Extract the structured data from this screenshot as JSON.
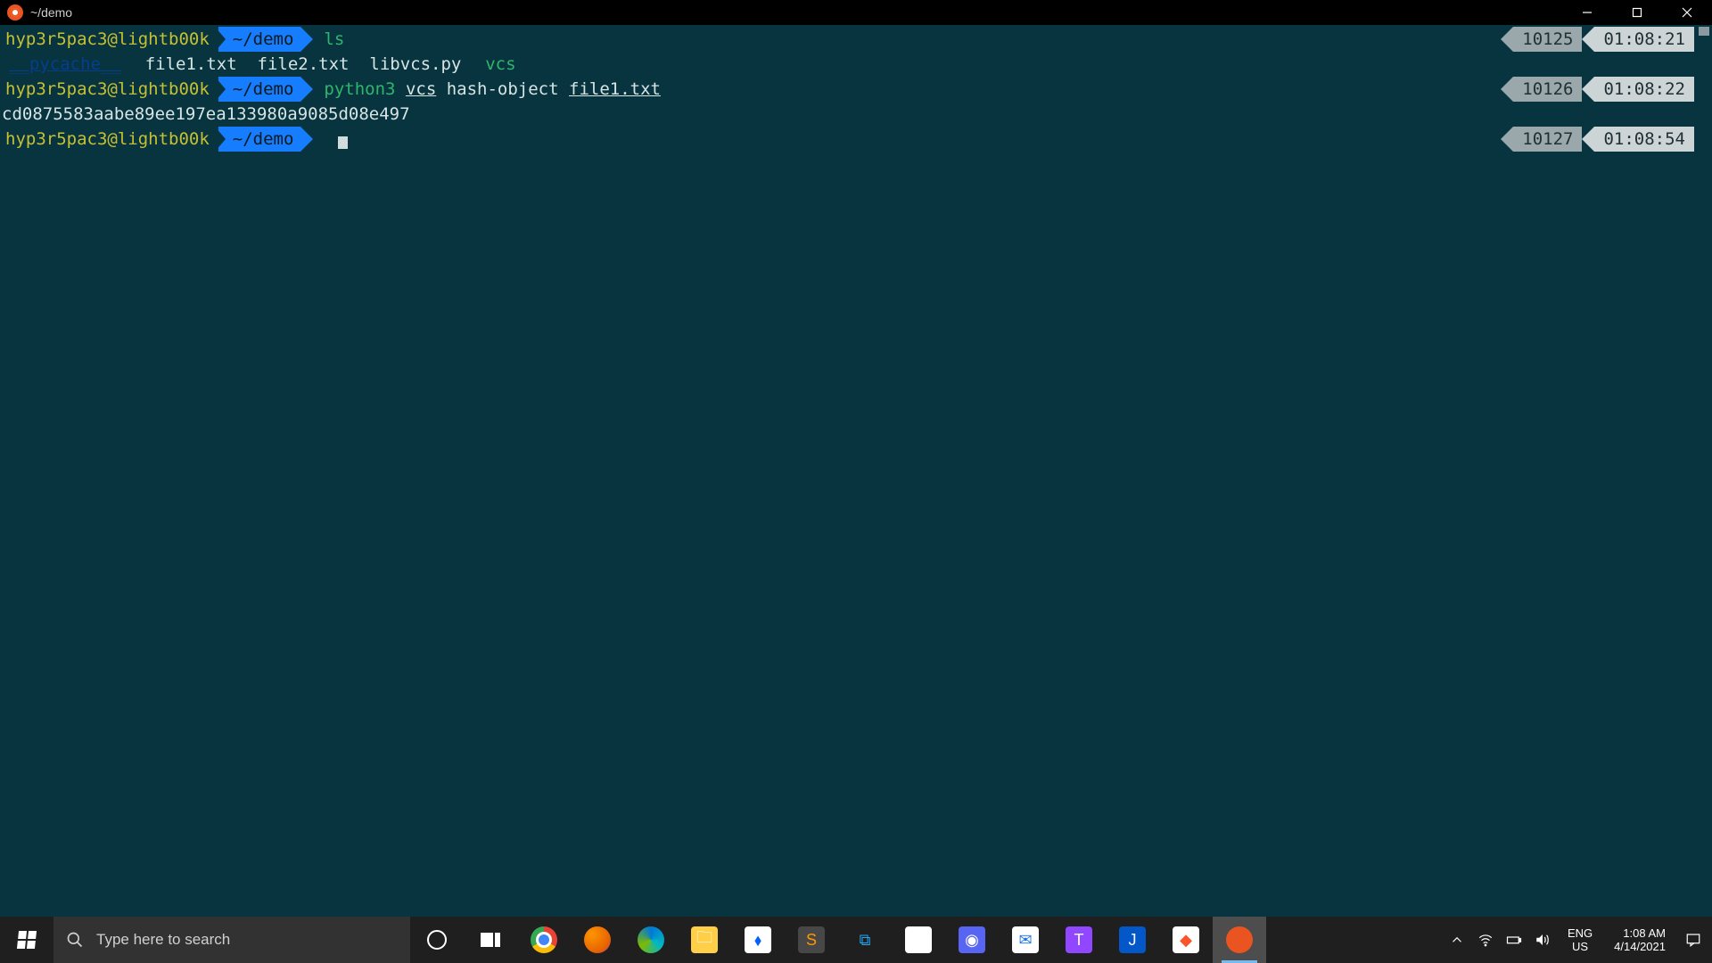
{
  "window": {
    "title": "~/demo"
  },
  "terminal": {
    "prompts": [
      {
        "user_host": "hyp3r5pac3@lightb00k",
        "dir": "~/demo",
        "command_tokens": [
          {
            "text": "ls",
            "cls": "tok-green"
          }
        ],
        "right": {
          "num": "10125",
          "time": "01:08:21"
        }
      },
      {
        "user_host": "hyp3r5pac3@lightb00k",
        "dir": "~/demo",
        "command_tokens": [
          {
            "text": "python3",
            "cls": "tok-green"
          },
          {
            "text": " ",
            "cls": "tok-white"
          },
          {
            "text": "vcs",
            "cls": "tok-white tok-under"
          },
          {
            "text": " hash-object ",
            "cls": "tok-white"
          },
          {
            "text": "file1.txt",
            "cls": "tok-white tok-under"
          }
        ],
        "right": {
          "num": "10126",
          "time": "01:08:22"
        }
      },
      {
        "user_host": "hyp3r5pac3@lightb00k",
        "dir": "~/demo",
        "command_tokens": [],
        "right": {
          "num": "10127",
          "time": "01:08:54"
        },
        "cursor": true
      }
    ],
    "ls_output": [
      {
        "text": "__pycache__",
        "cls": "tok-dir-blue"
      },
      {
        "text": "  file1.txt  file2.txt  libvcs.py  ",
        "cls": "tok-white"
      },
      {
        "text": "vcs",
        "cls": "tok-exec"
      }
    ],
    "hash_output": "cd0875583aabe89ee197ea133980a9085d08e497"
  },
  "taskbar": {
    "search_placeholder": "Type here to search",
    "apps": [
      {
        "name": "chrome",
        "label": "Google Chrome"
      },
      {
        "name": "firefox",
        "label": "Firefox"
      },
      {
        "name": "edge",
        "label": "Microsoft Edge"
      },
      {
        "name": "explorer",
        "label": "File Explorer"
      },
      {
        "name": "dropbox",
        "label": "Dropbox"
      },
      {
        "name": "sublime",
        "label": "Sublime Text"
      },
      {
        "name": "vscode",
        "label": "VS Code"
      },
      {
        "name": "slack",
        "label": "Slack"
      },
      {
        "name": "discord",
        "label": "Discord"
      },
      {
        "name": "messages",
        "label": "Messages"
      },
      {
        "name": "twitch",
        "label": "Twitch"
      },
      {
        "name": "joplin",
        "label": "Joplin"
      },
      {
        "name": "brave",
        "label": "Brave"
      },
      {
        "name": "ubuntu",
        "label": "Ubuntu Terminal",
        "active": true
      }
    ],
    "lang_top": "ENG",
    "lang_bottom": "US",
    "clock_time": "1:08 AM",
    "clock_date": "4/14/2021"
  }
}
